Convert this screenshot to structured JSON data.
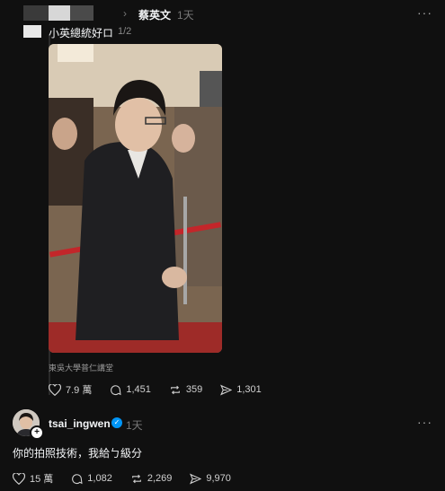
{
  "post": {
    "author": "蔡英文",
    "time": "1天",
    "more": "···",
    "caption": "小英總統好ロ",
    "page_indicator": "1/2",
    "location": "東吳大學普仁講堂",
    "likes": "7.9 萬",
    "comments": "1,451",
    "reposts": "359",
    "shares": "1,301"
  },
  "reply": {
    "username": "tsai_ingwen",
    "time": "1天",
    "more": "···",
    "text": "你的拍照技術，我給ㄅ級分",
    "likes": "15 萬",
    "comments": "1,082",
    "reposts": "2,269",
    "shares": "9,970"
  },
  "icons": [
    "chevron-right-icon",
    "more-icon",
    "heart-icon",
    "comment-icon",
    "repost-icon",
    "share-icon",
    "verified-icon",
    "follow-plus-icon"
  ],
  "colors": {
    "background": "#101010",
    "text": "#f3f5f7",
    "muted": "#777777",
    "verified": "#0095f6"
  }
}
